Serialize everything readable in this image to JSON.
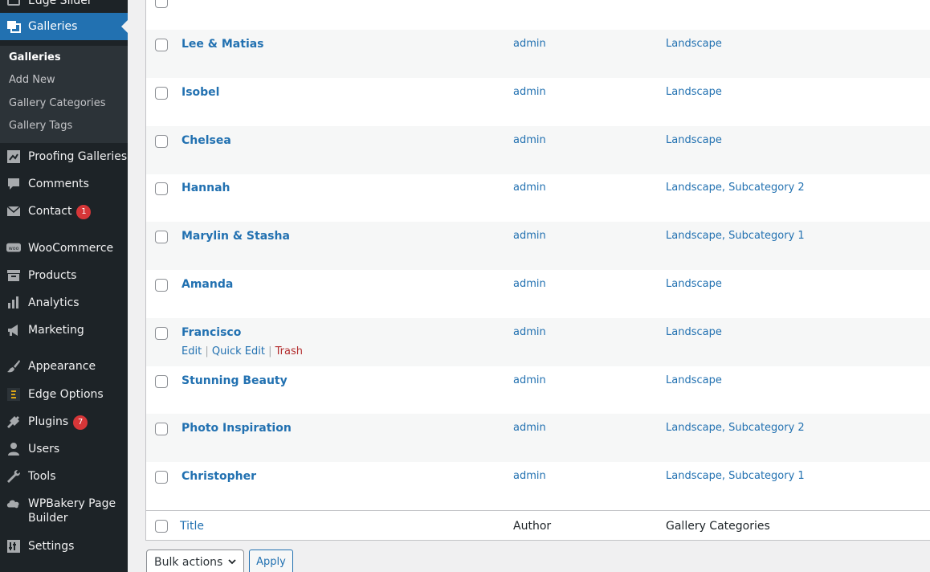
{
  "sidebar": {
    "items": [
      {
        "label": "Edge Slider",
        "icon": "slider-icon"
      },
      {
        "label": "Galleries",
        "icon": "gallery-icon"
      },
      {
        "label": "Proofing Galleries",
        "icon": "proofing-icon"
      },
      {
        "label": "Comments",
        "icon": "comment-icon"
      },
      {
        "label": "Contact",
        "icon": "mail-icon",
        "badge": "1"
      },
      {
        "label": "WooCommerce",
        "icon": "woo-icon"
      },
      {
        "label": "Products",
        "icon": "archive-icon"
      },
      {
        "label": "Analytics",
        "icon": "chart-icon"
      },
      {
        "label": "Marketing",
        "icon": "megaphone-icon"
      },
      {
        "label": "Appearance",
        "icon": "brush-icon"
      },
      {
        "label": "Edge Options",
        "icon": "edge-icon"
      },
      {
        "label": "Plugins",
        "icon": "plug-icon",
        "badge": "7"
      },
      {
        "label": "Users",
        "icon": "user-icon"
      },
      {
        "label": "Tools",
        "icon": "wrench-icon"
      },
      {
        "label": "WPBakery Page Builder",
        "label_line1": "WPBakery Page",
        "label_line2": "Builder",
        "icon": "cloud-icon"
      },
      {
        "label": "Settings",
        "icon": "settings-icon"
      }
    ],
    "submenu": [
      "Galleries",
      "Add New",
      "Gallery Categories",
      "Gallery Tags"
    ]
  },
  "table": {
    "rows": [
      {
        "title": "Lee & Matias",
        "author": "admin",
        "categories": "Landscape"
      },
      {
        "title": "Isobel",
        "author": "admin",
        "categories": "Landscape"
      },
      {
        "title": "Chelsea",
        "author": "admin",
        "categories": "Landscape"
      },
      {
        "title": "Hannah",
        "author": "admin",
        "categories": "Landscape, Subcategory 2"
      },
      {
        "title": "Marylin & Stasha",
        "author": "admin",
        "categories": "Landscape, Subcategory 1"
      },
      {
        "title": "Amanda",
        "author": "admin",
        "categories": "Landscape"
      },
      {
        "title": "Francisco",
        "author": "admin",
        "categories": "Landscape"
      },
      {
        "title": "Stunning Beauty",
        "author": "admin",
        "categories": "Landscape"
      },
      {
        "title": "Photo Inspiration",
        "author": "admin",
        "categories": "Landscape, Subcategory 2"
      },
      {
        "title": "Christopher",
        "author": "admin",
        "categories": "Landscape, Subcategory 1"
      }
    ],
    "row_actions": {
      "edit": "Edit",
      "quick_edit": "Quick Edit",
      "trash": "Trash",
      "separator": "|"
    },
    "footer": {
      "title": "Title",
      "author": "Author",
      "categories": "Gallery Categories"
    }
  },
  "bulk": {
    "select_label": "Bulk actions",
    "apply_label": "Apply"
  },
  "colors": {
    "sidebar_bg": "#1d2327",
    "accent": "#2271b1",
    "badge": "#d63638",
    "trash": "#b32d2e"
  }
}
